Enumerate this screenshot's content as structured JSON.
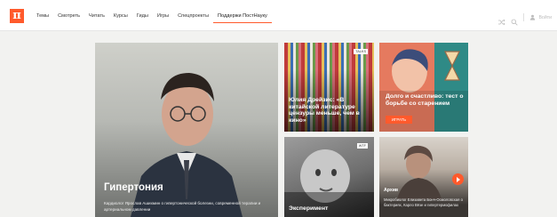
{
  "brand": {
    "logo_glyph": "π",
    "accent": "#ff5a2c"
  },
  "nav": {
    "items": [
      {
        "label": "Темы",
        "active": false
      },
      {
        "label": "Смотреть",
        "active": false
      },
      {
        "label": "Читать",
        "active": false
      },
      {
        "label": "Курсы",
        "active": false
      },
      {
        "label": "Гиды",
        "active": false
      },
      {
        "label": "Игры",
        "active": false
      },
      {
        "label": "Спецпроекты",
        "active": false
      },
      {
        "label": "Поддержи ПостНауку",
        "active": true
      }
    ],
    "login_label": "Войти",
    "icons": [
      "shuffle-icon",
      "search-icon",
      "user-icon"
    ]
  },
  "cards": {
    "featured": {
      "title": "Гипертония",
      "description": "Кардиолог Ярослав Ашихмин о гипертонической болезни, современной терапии и артериальном давлении"
    },
    "books": {
      "tag": "TALKS",
      "title": "Юлия Дрейзис: «В китайской литературе цензуры меньше, чем в кино»"
    },
    "aging": {
      "title": "Долго и счастливо: тест о борьбе со старением",
      "button_label": "ИГРАТЬ"
    },
    "experiment": {
      "tag": "WTF",
      "title": "Эксперимент"
    },
    "archive": {
      "label": "Архив",
      "description": "Микробиолог Елизавета Бонч-Осмоловская о бактериях, Карло Вёзе и гипертермофилах"
    }
  }
}
